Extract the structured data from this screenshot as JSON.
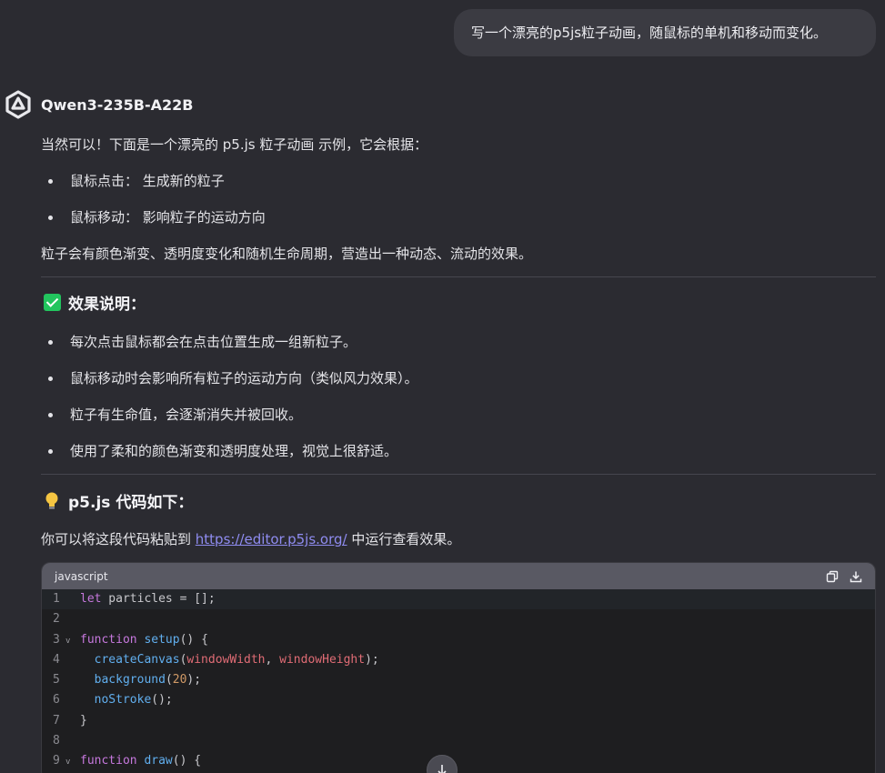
{
  "user_message": "写一个漂亮的p5js粒子动画，随鼠标的单机和移动而变化。",
  "assistant": {
    "model_name": "Qwen3-235B-A22B",
    "intro": "当然可以！下面是一个漂亮的 p5.js 粒子动画 示例，它会根据：",
    "intro_bullets": [
      "鼠标点击： 生成新的粒子",
      "鼠标移动： 影响粒子的运动方向"
    ],
    "summary": "粒子会有颜色渐变、透明度变化和随机生命周期，营造出一种动态、流动的效果。",
    "section1_title": "效果说明：",
    "section1_bullets": [
      "每次点击鼠标都会在点击位置生成一组新粒子。",
      "鼠标移动时会影响所有粒子的运动方向（类似风力效果）。",
      "粒子有生命值，会逐渐消失并被回收。",
      "使用了柔和的颜色渐变和透明度处理，视觉上很舒适。"
    ],
    "section2_title": "p5.js 代码如下：",
    "editor_text_before": "你可以将这段代码粘贴到 ",
    "editor_link": "https://editor.p5js.org/",
    "editor_text_after": " 中运行查看效果。"
  },
  "code_block": {
    "language": "javascript",
    "line_numbers": [
      "1",
      "2",
      "3",
      "4",
      "5",
      "6",
      "7",
      "8",
      "9"
    ]
  },
  "icons": {
    "copy": "copy-icon",
    "download": "download-icon",
    "scroll": "arrow-down-icon",
    "logo": "qwen-logo"
  },
  "colors": {
    "check": "#22c55e",
    "link": "#8f8cf0",
    "bulb": "#f5c542"
  }
}
